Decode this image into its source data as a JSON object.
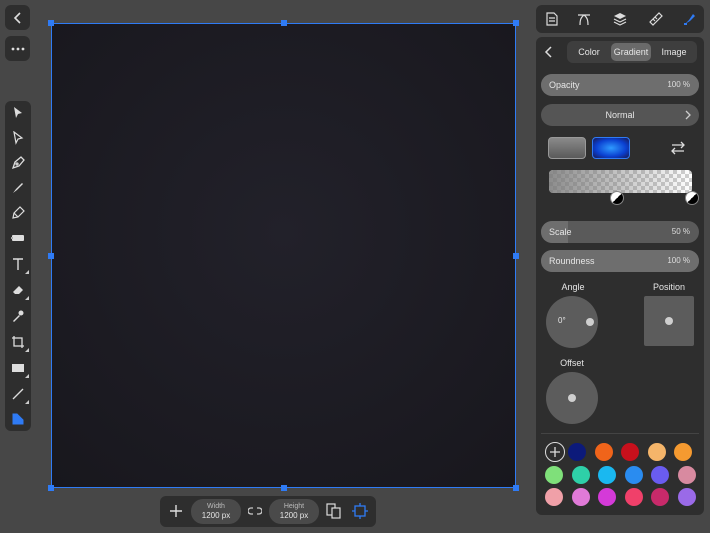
{
  "tabs": [
    {
      "label": "Color"
    },
    {
      "label": "Gradient"
    },
    {
      "label": "Image"
    }
  ],
  "opacity": {
    "label": "Opacity",
    "value": "100 %",
    "level": 1.0
  },
  "blend_mode": "Normal",
  "scale": {
    "label": "Scale",
    "value": "50 %",
    "level": 0.17
  },
  "roundness": {
    "label": "Roundness",
    "value": "100 %",
    "level": 1.0
  },
  "angle": {
    "label": "Angle",
    "value": "0°"
  },
  "position_label": "Position",
  "offset_label": "Offset",
  "dimensions": {
    "width_label": "Width",
    "width_value": "1200 px",
    "height_label": "Height",
    "height_value": "1200 px"
  },
  "colors": {
    "accent": "#2f7bf5",
    "canvas": "#1c1b22"
  },
  "swatches": [
    "#0c1a7a",
    "#f0641a",
    "#c8101c",
    "#f5b56a",
    "#f59a30",
    "#7fe07a",
    "#2ed0a8",
    "#1ab8f0",
    "#2a8cf0",
    "#6a5cf0",
    "#d88aa0",
    "#f0a0a8",
    "#e07ad8",
    "#d43ad8",
    "#f0406a",
    "#c82a6a",
    "#9a6ae8"
  ]
}
